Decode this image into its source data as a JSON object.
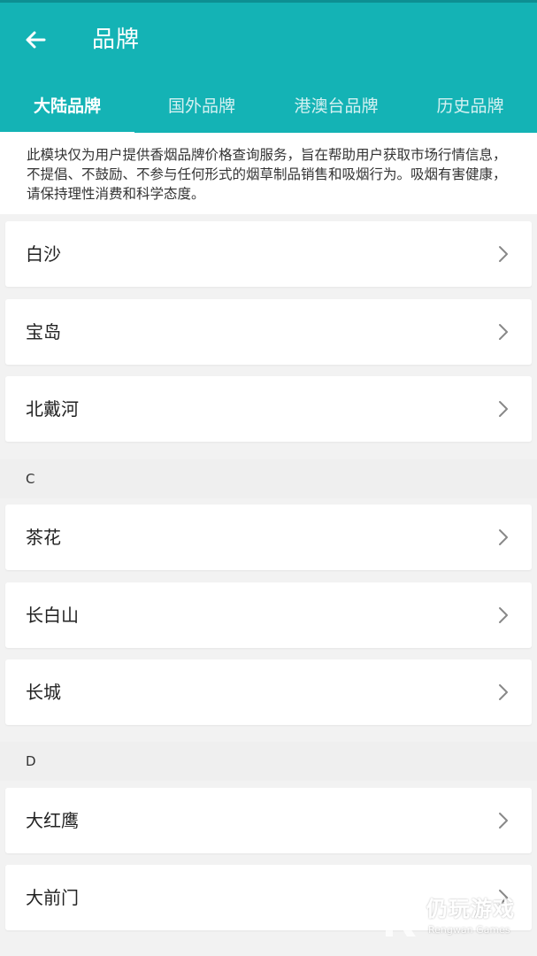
{
  "header": {
    "title": "品牌",
    "background_color": "#14b3b5",
    "back_icon": "arrow-left-icon"
  },
  "tabs": [
    {
      "label": "大陆品牌",
      "active": true
    },
    {
      "label": "国外品牌",
      "active": false
    },
    {
      "label": "港澳台品牌",
      "active": false
    },
    {
      "label": "历史品牌",
      "active": false
    }
  ],
  "notice": {
    "text": "此模块仅为用户提供香烟品牌价格查询服务，旨在帮助用户获取市场行情信息，不提倡、不鼓励、不参与任何形式的烟草制品销售和吸烟行为。吸烟有害健康，请保持理性消费和科学态度。"
  },
  "list": {
    "group_b": {
      "items": [
        "白沙",
        "宝岛",
        "北戴河"
      ]
    },
    "group_c": {
      "header": "C",
      "items": [
        "茶花",
        "长白山",
        "长城"
      ]
    },
    "group_d": {
      "header": "D",
      "items": [
        "大红鹰",
        "大前门"
      ]
    },
    "chevron_icon": "chevron-right-icon"
  },
  "watermark": {
    "title": "仍玩游戏",
    "subtitle": "Rengwan Games"
  }
}
